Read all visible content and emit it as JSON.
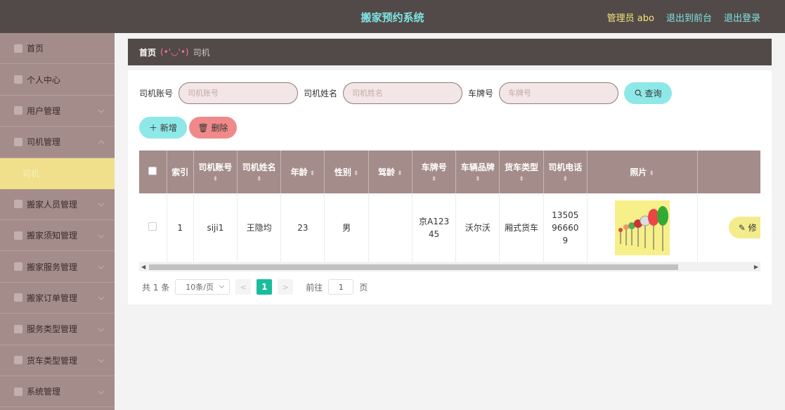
{
  "header": {
    "title": "搬家预约系统",
    "admin": "管理员 abo",
    "front": "退出到前台",
    "logout": "退出登录"
  },
  "sidebar": {
    "items": [
      {
        "label": "首页",
        "icon": "home-icon"
      },
      {
        "label": "个人中心",
        "icon": "user-icon"
      },
      {
        "label": "用户管理",
        "icon": "users-icon"
      },
      {
        "label": "司机管理",
        "icon": "driver-icon"
      },
      {
        "label": "搬家人员管理",
        "icon": "staff-icon"
      },
      {
        "label": "搬家须知管理",
        "icon": "notice-icon"
      },
      {
        "label": "搬家服务管理",
        "icon": "service-icon"
      },
      {
        "label": "搬家订单管理",
        "icon": "order-icon"
      },
      {
        "label": "服务类型管理",
        "icon": "list-icon"
      },
      {
        "label": "货车类型管理",
        "icon": "truck-icon"
      },
      {
        "label": "系统管理",
        "icon": "system-icon"
      }
    ],
    "sub_item": "司机"
  },
  "breadcrumb": {
    "home": "首页",
    "face": "(•'◡'•)",
    "current": "司机"
  },
  "search": {
    "account_label": "司机账号",
    "account_placeholder": "司机账号",
    "name_label": "司机姓名",
    "name_placeholder": "司机姓名",
    "plate_label": "车牌号",
    "plate_placeholder": "车牌号",
    "button": "查询"
  },
  "actions": {
    "add": "新增",
    "delete": "删除"
  },
  "table": {
    "headers": [
      "索引",
      "司机账号",
      "司机姓名",
      "年龄",
      "性别",
      "驾龄",
      "车牌号",
      "车辆品牌",
      "货车类型",
      "司机电话",
      "照片"
    ],
    "row": {
      "index": "1",
      "account": "siji1",
      "name": "王隐均",
      "age": "23",
      "gender": "男",
      "years": "",
      "plate": "京A12345",
      "brand": "沃尔沃",
      "truck_type": "厢式货车",
      "phone": "13505966609",
      "edit": "修"
    }
  },
  "pagination": {
    "total": "共 1 条",
    "page_size": "10条/页",
    "current": "1",
    "goto": "前往",
    "page_input": "1",
    "page_unit": "页"
  },
  "colors": {
    "topbar": "#524a48",
    "sidebar": "#a48c8a",
    "accent_cyan": "#8ee8e8",
    "accent_red": "#f08a8a",
    "accent_yellow": "#f0e08c",
    "pager_green": "#1abc9c"
  }
}
